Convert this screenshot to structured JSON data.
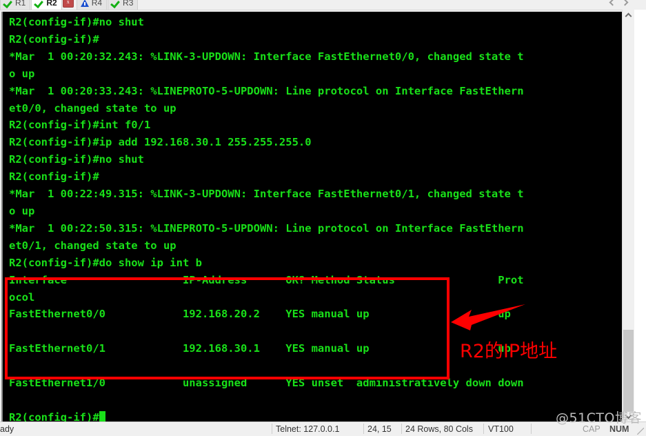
{
  "tabbar": {
    "tabs": [
      {
        "label": "R1",
        "icon": "green-check-icon",
        "active": false
      },
      {
        "label": "R2",
        "icon": "green-check-icon",
        "active": true
      },
      {
        "label": "R4",
        "icon": "blue-warning-icon",
        "active": false
      },
      {
        "label": "R3",
        "icon": "green-check-icon",
        "active": false
      }
    ],
    "close_label": "x",
    "nav_prev": "◁",
    "nav_next": "▷"
  },
  "terminal": {
    "lines": [
      "R2(config-if)#no shut",
      "R2(config-if)#",
      "*Mar  1 00:20:32.243: %LINK-3-UPDOWN: Interface FastEthernet0/0, changed state t",
      "o up",
      "*Mar  1 00:20:33.243: %LINEPROTO-5-UPDOWN: Line protocol on Interface FastEthern",
      "et0/0, changed state to up",
      "R2(config-if)#int f0/1",
      "R2(config-if)#ip add 192.168.30.1 255.255.255.0",
      "R2(config-if)#no shut",
      "R2(config-if)#",
      "*Mar  1 00:22:49.315: %LINK-3-UPDOWN: Interface FastEthernet0/1, changed state t",
      "o up",
      "*Mar  1 00:22:50.315: %LINEPROTO-5-UPDOWN: Line protocol on Interface FastEthern",
      "et0/1, changed state to up",
      "R2(config-if)#do show ip int b",
      "Interface                  IP-Address      OK? Method Status                Prot",
      "ocol",
      "FastEthernet0/0            192.168.20.2    YES manual up                    up",
      "",
      "FastEthernet0/1            192.168.30.1    YES manual up                    up",
      "",
      "FastEthernet1/0            unassigned      YES unset  administratively down down",
      "",
      "R2(config-if)#"
    ],
    "prompt_tail": "R2(config-if)#",
    "cursor": "block",
    "fg_color": "#19e019",
    "bg_color": "#000000"
  },
  "annotation": {
    "box_color": "#ff0000",
    "arrow_label": "arrow-pointing-left",
    "text": "R2的IP地址"
  },
  "scrollbar": {
    "up_arrow": "▲",
    "down_arrow": "▼"
  },
  "statusbar": {
    "ready": "ady",
    "telnet": "Telnet: 127.0.0.1",
    "position": "24, 15",
    "dimensions": "24 Rows, 80 Cols",
    "emulation": "VT100",
    "cap": "CAP",
    "num": "NUM"
  },
  "watermark": "@51CTO博客"
}
